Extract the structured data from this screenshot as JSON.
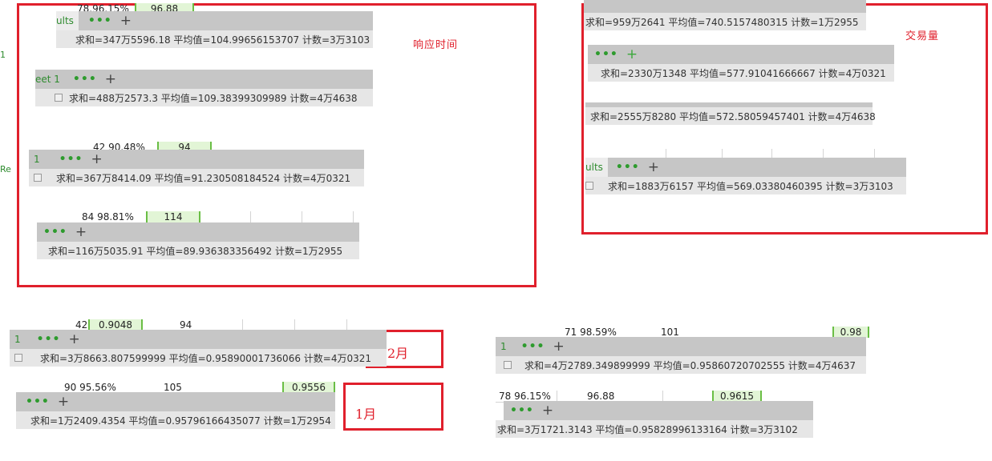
{
  "labels": {
    "response_time": "响应时间",
    "trade_volume": "交易量",
    "feb": "2月",
    "jan": "1月"
  },
  "left_fragments": {
    "a": "1",
    "b": "Re"
  },
  "panel1": {
    "cells": {
      "c1": "78.96.15%",
      "c2": "96.88"
    },
    "tab": "ults",
    "status": "求和=347万5596.18  平均值=104.99656153707  计数=3万3103"
  },
  "panel2": {
    "tab": "eet 1",
    "status": "求和=488万2573.3  平均值=109.38399309989  计数=4万4638"
  },
  "panel3": {
    "cells": {
      "c1": "42 90.48%",
      "c2": "94"
    },
    "tab": "1",
    "status": "求和=367万8414.09  平均值=91.230508184524  计数=4万0321"
  },
  "panel4": {
    "cells": {
      "c1": "84 98.81%",
      "c2": "114"
    },
    "status": "求和=116万5035.91  平均值=89.936383356492  计数=1万2955"
  },
  "panel5": {
    "status": "求和=959万2641  平均值=740.5157480315  计数=1万2955"
  },
  "panel6": {
    "status": "求和=2330万1348  平均值=577.91041666667  计数=4万0321"
  },
  "panel7": {
    "status": "求和=2555万8280  平均值=572.58059457401  计数=4万4638"
  },
  "panel8": {
    "tab": "ults",
    "status": "求和=1883万6157  平均值=569.03380460395  计数=3万3103"
  },
  "panel9": {
    "cells": {
      "c1": "42",
      "c2": "0.9048",
      "c3": "94"
    },
    "tab": "1",
    "status": "求和=3万8663.807599999  平均值=0.95890001736066  计数=4万0321"
  },
  "panel10": {
    "cells": {
      "c1": "90 95.56%",
      "c2": "105",
      "c3": "0.9556"
    },
    "status": "求和=1万2409.4354  平均值=0.95796166435077  计数=1万2954"
  },
  "panel11": {
    "cells": {
      "c1": "71 98.59%",
      "c2": "101",
      "c3": "0.98"
    },
    "tab": "1",
    "status": "求和=4万2789.349899999  平均值=0.95860720702555  计数=4万4637"
  },
  "panel12": {
    "cells": {
      "c1": "78 96.15%",
      "c2": "96.88",
      "c3": "0.9615"
    },
    "status": "求和=3万1721.3143  平均值=0.95828996133164  计数=3万3102"
  }
}
